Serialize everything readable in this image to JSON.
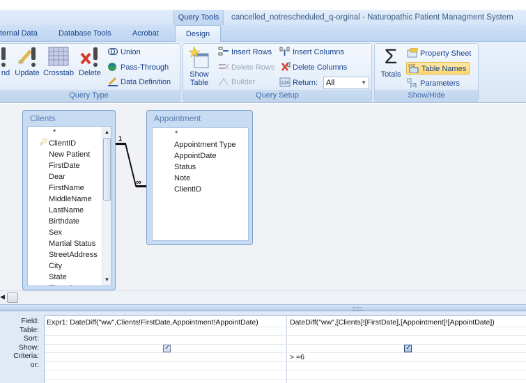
{
  "titlebar": {
    "context_tab": "Query Tools",
    "window_title": "cancelled_notrescheduled_q-orginal - Naturopathic Patient Managment System"
  },
  "tabs": [
    {
      "label": "ternal Data",
      "active": false
    },
    {
      "label": "Database Tools",
      "active": false
    },
    {
      "label": "Acrobat",
      "active": false
    },
    {
      "label": "Design",
      "active": true
    }
  ],
  "ribbon": {
    "query_type": {
      "label": "Query Type",
      "big_buttons": [
        "nd",
        "Update",
        "Crosstab",
        "Delete"
      ],
      "small_buttons": [
        "Union",
        "Pass-Through",
        "Data Definition"
      ]
    },
    "query_setup": {
      "label": "Query Setup",
      "show_table": [
        "Show",
        "Table"
      ],
      "insert_rows": "Insert Rows",
      "delete_rows": "Delete Rows",
      "builder": "Builder",
      "insert_columns": "Insert Columns",
      "delete_columns": "Delete Columns",
      "return_label": "Return:",
      "return_value": "All"
    },
    "show_hide": {
      "label": "Show/Hide",
      "totals": "Totals",
      "property_sheet": "Property Sheet",
      "table_names": "Table Names",
      "parameters": "Parameters"
    }
  },
  "tables": {
    "clients": {
      "title": "Clients",
      "fields": [
        "*",
        "ClientID",
        "New Patient",
        "FirstDate",
        "Dear",
        "FirstName",
        "MiddleName",
        "LastName",
        "Birthdate",
        "Sex",
        "Martial Status",
        "StreetAddress",
        "City",
        "State",
        "Zipcode"
      ],
      "primary_key": "ClientID"
    },
    "appointment": {
      "title": "Appointment",
      "fields": [
        "*",
        "Appointment Type",
        "AppointDate",
        "Status",
        "Note",
        "ClientID"
      ]
    },
    "relationship": {
      "one_label": "1",
      "many_label": "∞"
    }
  },
  "grid": {
    "row_labels": [
      "Field:",
      "Table:",
      "Sort:",
      "Show:",
      "Criteria:",
      "or:"
    ],
    "columns": [
      {
        "field": "Expr1: DateDiff(\"ww\",Clients!FirstDate,Appointment!AppointDate)",
        "table": "",
        "sort": "",
        "show": true,
        "criteria": "",
        "or": ""
      },
      {
        "field": "DateDiff(\"ww\",[Clients]![FirstDate],[Appointment]![AppointDate])",
        "table": "",
        "sort": "",
        "show": true,
        "criteria": "> =6",
        "or": ""
      }
    ]
  }
}
